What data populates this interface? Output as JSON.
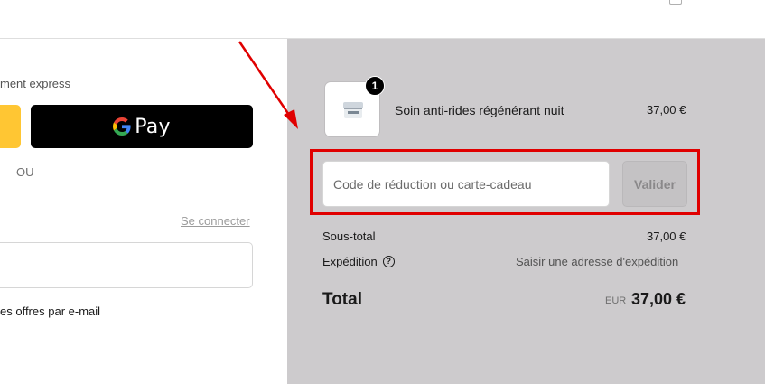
{
  "left_panel": {
    "express_label": "ment express",
    "gpay_label": "Pay",
    "or_text": "OU",
    "login_link": "Se connecter",
    "email_placeholder": "",
    "offers_text": "es offres par e-mail"
  },
  "order_summary": {
    "item": {
      "quantity": "1",
      "name": "Soin anti-rides régénérant nuit",
      "price": "37,00 €"
    },
    "discount": {
      "placeholder": "Code de réduction ou carte-cadeau",
      "value": "",
      "apply_label": "Valider"
    },
    "subtotal_label": "Sous-total",
    "subtotal_value": "37,00 €",
    "shipping_label": "Expédition",
    "shipping_value": "Saisir une adresse d'expédition",
    "total_label": "Total",
    "total_currency": "EUR",
    "total_value": "37,00 €"
  },
  "annotation": {
    "color": "#e00000",
    "highlighted_element": "discount-code-section"
  },
  "icons": {
    "gpay": "google-g-icon",
    "help": "question-circle-icon",
    "arrow": "red-arrow-annotation"
  },
  "colors": {
    "summary_background": "#cdcbcd",
    "express_shop_pay": "#ffc633",
    "gpay_button": "#000000",
    "annotation_red": "#e00000"
  }
}
